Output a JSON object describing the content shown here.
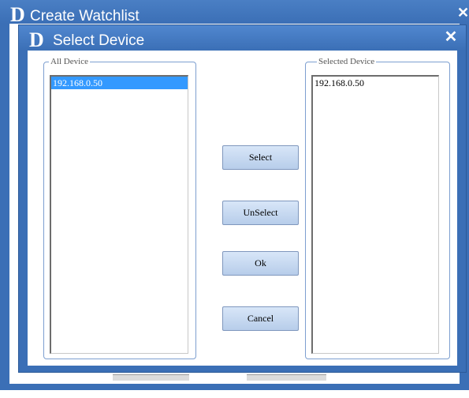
{
  "outer_window": {
    "logo": "D",
    "title": "Create Watchlist",
    "close_glyph": "✕"
  },
  "dialog": {
    "logo": "D",
    "title": "Select Device",
    "close_glyph": "✕"
  },
  "all_device": {
    "legend": "All Device",
    "items": [
      "192.168.0.50"
    ],
    "selected_index": 0
  },
  "selected_device": {
    "legend": "Selected Device",
    "items": [
      "192.168.0.50"
    ]
  },
  "buttons": {
    "select": "Select",
    "unselect": "UnSelect",
    "ok": "Ok",
    "cancel": "Cancel"
  },
  "colors": {
    "titlebar": "#3b6fb6",
    "selection": "#3399ff",
    "button": "#c8daf2"
  },
  "icons": {
    "logo": "dlink-logo-icon",
    "close": "close-icon"
  }
}
